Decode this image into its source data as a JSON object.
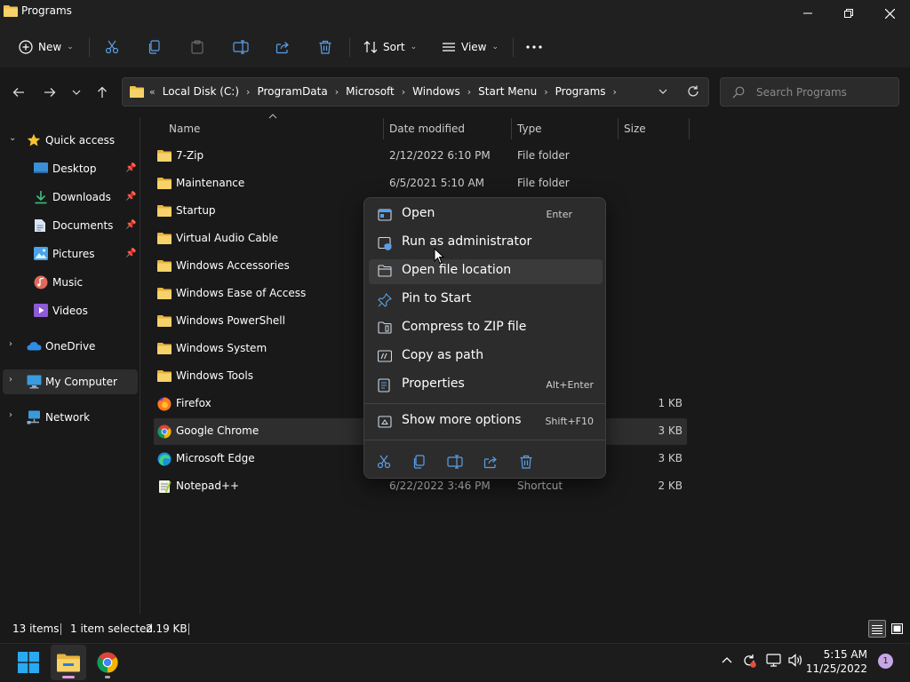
{
  "window": {
    "title": "Programs"
  },
  "toolbar": {
    "new_label": "New",
    "sort_label": "Sort",
    "view_label": "View"
  },
  "address": {
    "crumbs": [
      "Local Disk (C:)",
      "ProgramData",
      "Microsoft",
      "Windows",
      "Start Menu",
      "Programs"
    ]
  },
  "search": {
    "placeholder": "Search Programs"
  },
  "sidebar": {
    "items": [
      {
        "label": "Quick access"
      },
      {
        "label": "Desktop"
      },
      {
        "label": "Downloads"
      },
      {
        "label": "Documents"
      },
      {
        "label": "Pictures"
      },
      {
        "label": "Music"
      },
      {
        "label": "Videos"
      },
      {
        "label": "OneDrive"
      },
      {
        "label": "My Computer"
      },
      {
        "label": "Network"
      }
    ]
  },
  "columns": {
    "name": "Name",
    "date": "Date modified",
    "type": "Type",
    "size": "Size"
  },
  "files": [
    {
      "name": "7-Zip",
      "date": "2/12/2022 6:10 PM",
      "type": "File folder",
      "size": ""
    },
    {
      "name": "Maintenance",
      "date": "6/5/2021 5:10 AM",
      "type": "File folder",
      "size": ""
    },
    {
      "name": "Startup",
      "date": "",
      "type": "",
      "size": ""
    },
    {
      "name": "Virtual Audio Cable",
      "date": "",
      "type": "",
      "size": ""
    },
    {
      "name": "Windows Accessories",
      "date": "",
      "type": "",
      "size": ""
    },
    {
      "name": "Windows Ease of Access",
      "date": "",
      "type": "",
      "size": ""
    },
    {
      "name": "Windows PowerShell",
      "date": "",
      "type": "",
      "size": ""
    },
    {
      "name": "Windows System",
      "date": "",
      "type": "",
      "size": ""
    },
    {
      "name": "Windows Tools",
      "date": "",
      "type": "",
      "size": ""
    },
    {
      "name": "Firefox",
      "date": "",
      "type": "",
      "size": "1 KB"
    },
    {
      "name": "Google Chrome",
      "date": "",
      "type": "",
      "size": "3 KB"
    },
    {
      "name": "Microsoft Edge",
      "date": "",
      "type": "",
      "size": "3 KB"
    },
    {
      "name": "Notepad++",
      "date": "6/22/2022 3:46 PM",
      "type": "Shortcut",
      "size": "2 KB"
    }
  ],
  "context_menu": {
    "items": [
      {
        "label": "Open",
        "shortcut": "Enter"
      },
      {
        "label": "Run as administrator",
        "shortcut": ""
      },
      {
        "label": "Open file location",
        "shortcut": ""
      },
      {
        "label": "Pin to Start",
        "shortcut": ""
      },
      {
        "label": "Compress to ZIP file",
        "shortcut": ""
      },
      {
        "label": "Copy as path",
        "shortcut": ""
      },
      {
        "label": "Properties",
        "shortcut": "Alt+Enter"
      },
      {
        "label": "Show more options",
        "shortcut": "Shift+F10"
      }
    ]
  },
  "status": {
    "items_count": "13 items",
    "selection": "1 item selected",
    "selection_size": "2.19 KB"
  },
  "taskbar": {
    "time": "5:15 AM",
    "date": "11/25/2022",
    "notifications": "1"
  },
  "colors": {
    "folder": "#f0c14b",
    "accent": "#4cc2ff",
    "background": "#191919",
    "menu": "#2c2c2c"
  }
}
